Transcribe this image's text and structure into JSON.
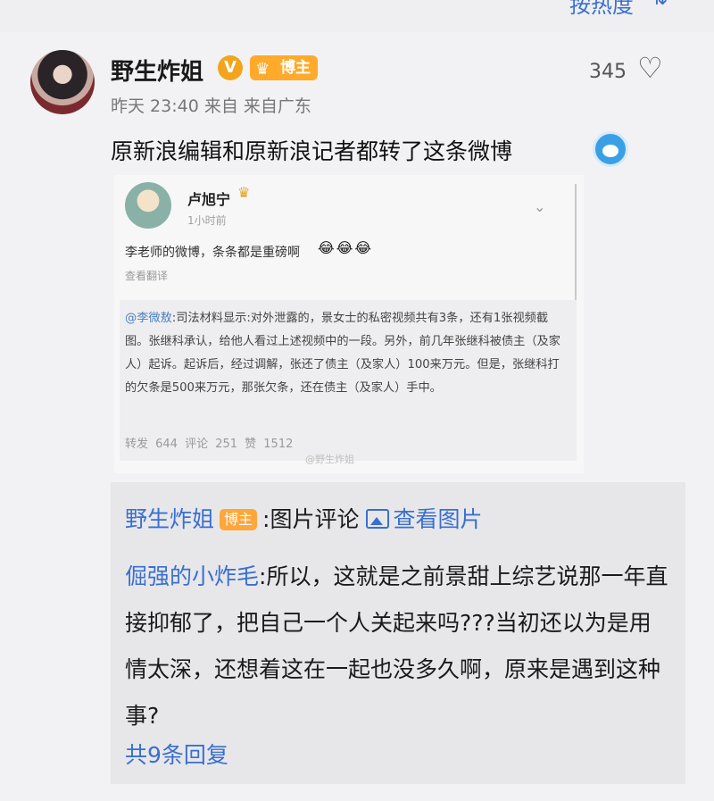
{
  "top": {
    "sort_label": "按热度",
    "sort_icon": "sort-icon"
  },
  "post": {
    "username": "野生炸姐",
    "verified_icon": "verified-v-icon",
    "badge": "博主",
    "likes": "345",
    "time": "昨天 23:40",
    "source": "来自",
    "location": "来自广东",
    "text": "原新浪编辑和原新浪记者都转了这条微博",
    "emoji_icon": "doraemon-emoji-icon"
  },
  "embedded_screenshot": {
    "name": "卢旭宁",
    "time": "1小时前",
    "text": "李老师的微博，条条都是重磅啊",
    "emojis": "😂😂😂",
    "translate": "查看翻译",
    "quote": {
      "mention": "@李微敖",
      "content": ":司法材料显示:对外泄露的，景女士的私密视频共有3条，还有1张视频截图。张继科承认，给他人看过上述视频中的一段。另外，前几年张继科被债主（及家人）起诉。起诉后，经过调解，张还了债主（及家人）100来万元。但是，张继科打的欠条是500来万元，那张欠条，还在债主（及家人）手中。"
    },
    "stats": "转发 644   评论 251   赞 1512",
    "watermark": "@野生炸姐"
  },
  "comment": {
    "author": "野生炸姐",
    "badge": "博主",
    "label": ":图片评论",
    "view_image": "查看图片",
    "reply_author": "倔强的小炸毛",
    "reply_text": ":所以，这就是之前景甜上综艺说那一年直接抑郁了，把自己一个人关起来吗???当初还以为是用情太深，还想着这在一起也没多久啊，原来是遇到这种事?",
    "more_replies": "共9条回复"
  }
}
